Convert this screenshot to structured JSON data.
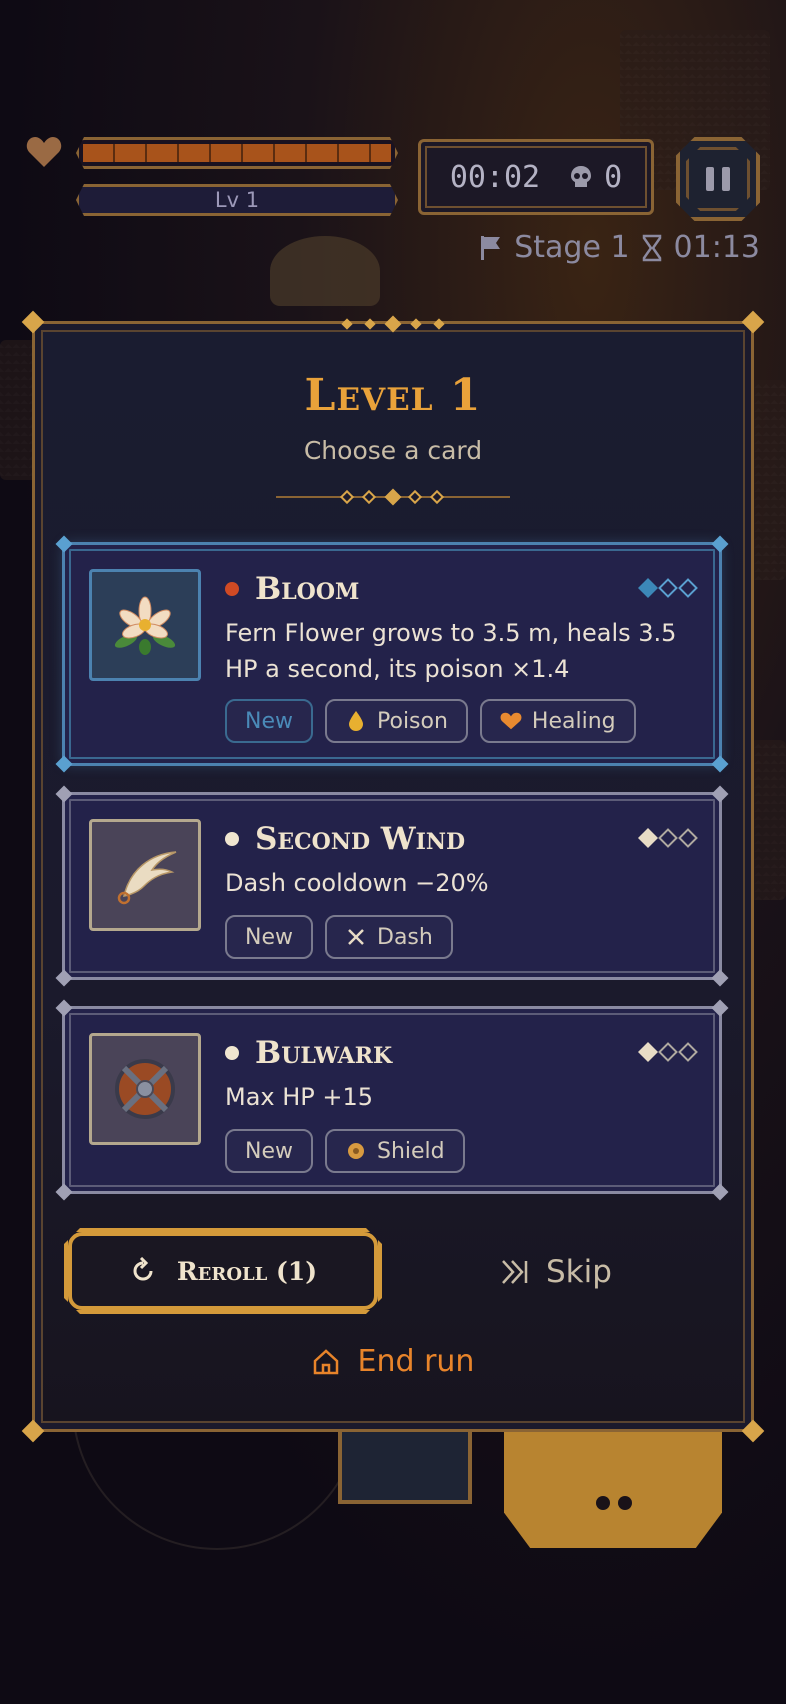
{
  "hud": {
    "level_label": "Lv 1",
    "hp_fraction": 1.0,
    "timer": "00:02",
    "kills": "0",
    "stage_label": "Stage 1",
    "stage_timer": "01:13"
  },
  "dialog": {
    "title": "Level 1",
    "subtitle": "Choose a card",
    "cards": [
      {
        "name": "Bloom",
        "description": "Fern Flower grows to 3.5 m, heals 3.5 HP a second, its poison ×1.4",
        "icon": "flower-icon",
        "rarity_color": "#d04a24",
        "level_pips_filled": 1,
        "level_pips_total": 3,
        "selected": true,
        "tags": [
          {
            "label": "New",
            "icon": ""
          },
          {
            "label": "Poison",
            "icon": "poison-drop-icon"
          },
          {
            "label": "Healing",
            "icon": "heart-icon"
          }
        ]
      },
      {
        "name": "Second Wind",
        "description": "Dash cooldown −20%",
        "icon": "feather-icon",
        "rarity_color": "#f0e6d0",
        "level_pips_filled": 1,
        "level_pips_total": 3,
        "selected": false,
        "tags": [
          {
            "label": "New",
            "icon": ""
          },
          {
            "label": "Dash",
            "icon": "dash-arrows-icon"
          }
        ]
      },
      {
        "name": "Bulwark",
        "description": "Max HP +15",
        "icon": "shield-icon",
        "rarity_color": "#f0e6d0",
        "level_pips_filled": 1,
        "level_pips_total": 3,
        "selected": false,
        "tags": [
          {
            "label": "New",
            "icon": ""
          },
          {
            "label": "Shield",
            "icon": "shield-badge-icon"
          }
        ]
      }
    ],
    "reroll_label": "Reroll (1)",
    "skip_label": "Skip",
    "end_run_label": "End run"
  },
  "colors": {
    "accent_gold": "#e9a23a",
    "end_run": "#e8842a",
    "selected_border": "#4c82b0"
  }
}
